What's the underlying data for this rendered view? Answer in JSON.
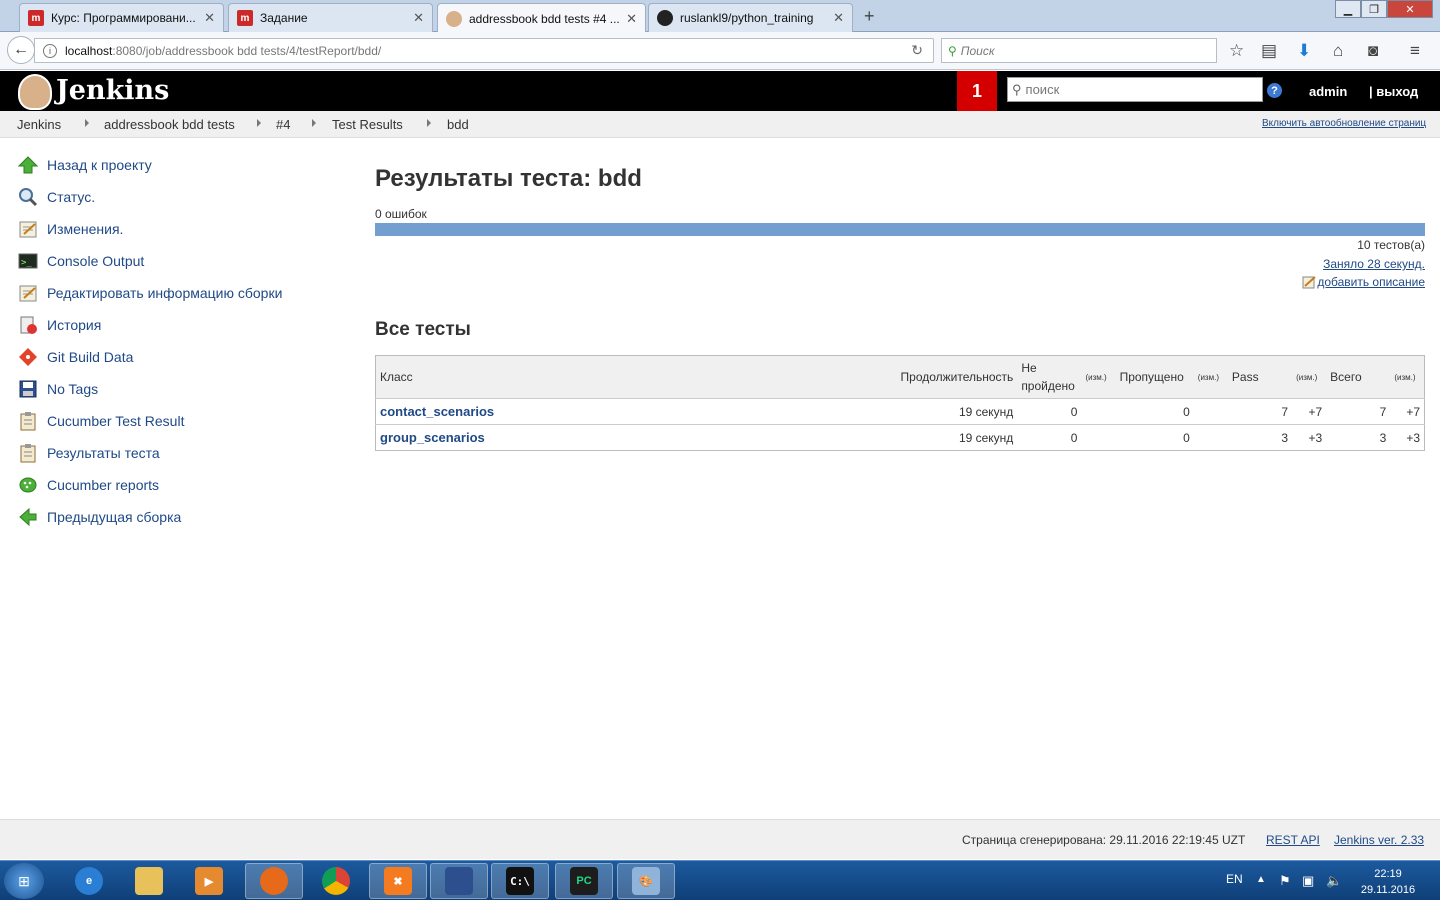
{
  "browser": {
    "tabs": [
      {
        "title": "Курс: Программировани...",
        "icon": "moodle-icon",
        "color": "#cc2a2a"
      },
      {
        "title": "Задание",
        "icon": "moodle-icon",
        "color": "#cc2a2a"
      },
      {
        "title": "addressbook bdd tests #4 ...",
        "icon": "jenkins-icon",
        "color": "#d8b08a"
      },
      {
        "title": "ruslankl9/python_training",
        "icon": "github-icon",
        "color": "#222222"
      }
    ],
    "url_host": "localhost",
    "url_rest": ":8080/job/addressbook bdd tests/4/testReport/bdd/",
    "search_placeholder": "Поиск"
  },
  "jenkins": {
    "name": "Jenkins",
    "badge_count": "1",
    "search_placeholder": "поиск",
    "user": "admin",
    "logout": "| выход",
    "help": "?"
  },
  "breadcrumbs": [
    "Jenkins",
    "addressbook bdd tests",
    "#4",
    "Test Results",
    "bdd"
  ],
  "autorefresh": "Включить автообновление страниц",
  "sidebar": [
    {
      "label": "Назад к проекту",
      "icon": "up-arrow-icon"
    },
    {
      "label": "Статус.",
      "icon": "magnifier-icon"
    },
    {
      "label": "Изменения.",
      "icon": "notepad-icon"
    },
    {
      "label": "Console Output",
      "icon": "terminal-icon"
    },
    {
      "label": "Редактировать информацию сборки",
      "icon": "notepad-icon"
    },
    {
      "label": "История",
      "icon": "history-icon"
    },
    {
      "label": "Git Build Data",
      "icon": "git-icon"
    },
    {
      "label": "No Tags",
      "icon": "save-icon"
    },
    {
      "label": "Cucumber Test Result",
      "icon": "clipboard-icon"
    },
    {
      "label": "Результаты теста",
      "icon": "clipboard-icon"
    },
    {
      "label": "Cucumber reports",
      "icon": "cucumber-icon"
    },
    {
      "label": "Предыдущая сборка",
      "icon": "left-arrow-icon"
    }
  ],
  "main": {
    "title": "Результаты теста: bdd",
    "failures": "0 ошибок",
    "pass_fraction": 1.0,
    "tests_count": "10 тестов(а)",
    "took": "Заняло 28 секунд.",
    "add_description": "добавить описание",
    "all_tests": "Все тесты"
  },
  "table": {
    "headers": {
      "class": "Класс",
      "duration": "Продолжительность",
      "failed_line1": "Не",
      "failed_line2": "пройдено",
      "diff": "(изм.)",
      "skipped": "Пропущено",
      "pass": "Pass",
      "total": "Всего"
    },
    "rows": [
      {
        "name": "contact_scenarios",
        "duration": "19 секунд",
        "failed": "0",
        "skipped": "0",
        "pass": "7",
        "pass_diff": "+7",
        "total": "7",
        "total_diff": "+7"
      },
      {
        "name": "group_scenarios",
        "duration": "19 секунд",
        "failed": "0",
        "skipped": "0",
        "pass": "3",
        "pass_diff": "+3",
        "total": "3",
        "total_diff": "+3"
      }
    ]
  },
  "footer": {
    "generated": "Страница сгенерирована: 29.11.2016 22:19:45 UZT",
    "rest_api": "REST API",
    "version": "Jenkins ver. 2.33"
  },
  "taskbar": {
    "lang": "EN",
    "time": "22:19",
    "date": "29.11.2016"
  }
}
